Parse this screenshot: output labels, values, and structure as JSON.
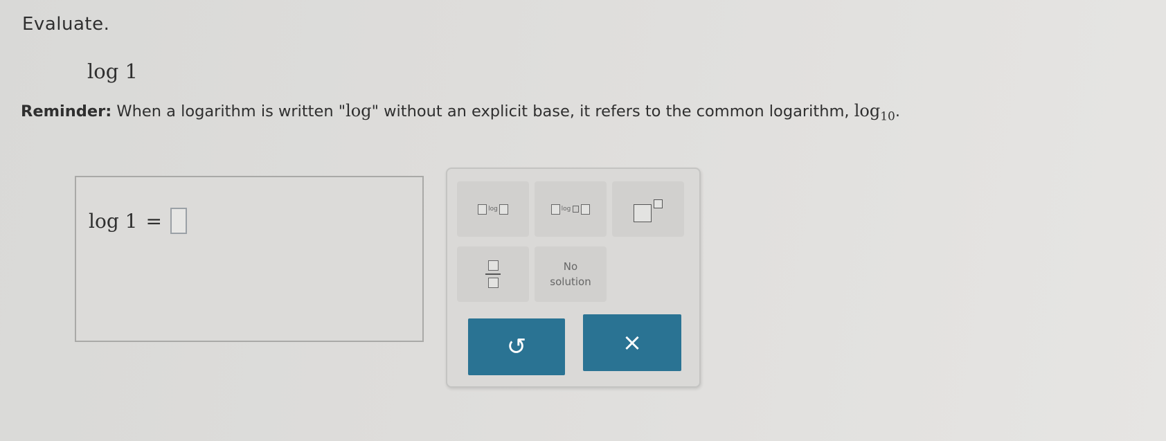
{
  "instruction": "Evaluate.",
  "problem": {
    "text": "log 1"
  },
  "reminder": {
    "label": "Reminder:",
    "text_before": " When a logarithm is written \"",
    "log_word": "log",
    "text_after": "\" without an explicit base, it refers to the common logarithm, ",
    "common_log": "log",
    "base": "10",
    "end": "."
  },
  "answer": {
    "lhs": "log 1",
    "equals": "="
  },
  "palette": {
    "log_template_label": "log",
    "log_base_label": "log",
    "no_solution_line1": "No",
    "no_solution_line2": "solution",
    "undo_glyph": "↺",
    "clear_glyph": "×"
  },
  "colors": {
    "accent": "#2a7393"
  }
}
